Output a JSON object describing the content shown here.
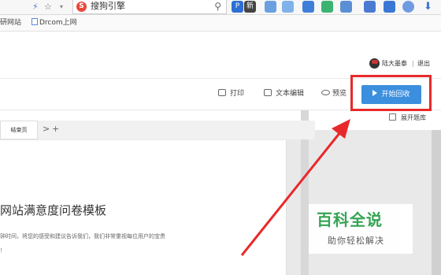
{
  "browser": {
    "search_text": "搜狗引擎",
    "ext_badge": "新"
  },
  "bookmarks": [
    {
      "label": "研网站"
    },
    {
      "label": "Drcom上网"
    }
  ],
  "user": {
    "name": "陆大墨泰",
    "separator": "|",
    "logout": "退出"
  },
  "editor_toolbar": {
    "print": "打印",
    "text_edit": "文本编辑",
    "preview": "预览",
    "start_collect": "开始回收",
    "expand_bank": "展开题库"
  },
  "page_tabs": {
    "tab_end": "结束页",
    "next": ">",
    "add": "+"
  },
  "document": {
    "title": "网站满意度问卷模板",
    "desc_line1": "钟时间，将您的感受和建议告诉我们，我们非常重视每位用户的宝贵",
    "desc_line2": "！"
  },
  "watermark": {
    "main": "百科全说",
    "sub": "助你轻松解决"
  },
  "colors": {
    "primary_button": "#3b8fde",
    "highlight": "#e8292b",
    "watermark_green": "#2ea24e"
  }
}
